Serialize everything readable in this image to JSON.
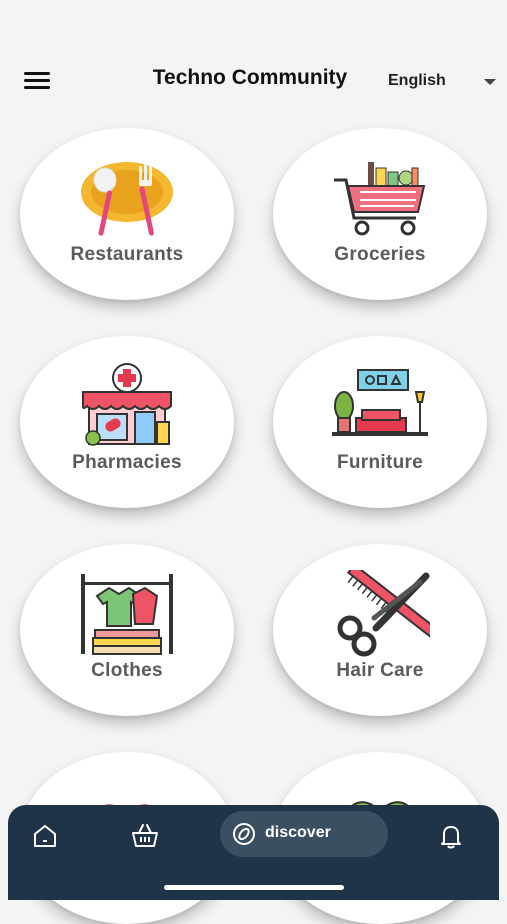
{
  "header": {
    "title": "Techno Community",
    "language": "English"
  },
  "categories": [
    {
      "label": "Restaurants",
      "icon": "restaurant-icon"
    },
    {
      "label": "Groceries",
      "icon": "grocery-cart-icon"
    },
    {
      "label": "Pharmacies",
      "icon": "pharmacy-icon"
    },
    {
      "label": "Furniture",
      "icon": "furniture-icon"
    },
    {
      "label": "Clothes",
      "icon": "clothes-rack-icon"
    },
    {
      "label": "Hair Care",
      "icon": "hair-care-icon"
    },
    {
      "label": "",
      "icon": "health-heart-icon"
    },
    {
      "label": "",
      "icon": "pet-icon"
    }
  ],
  "bottom_nav": {
    "items": [
      "home-icon",
      "basket-icon",
      "discover-icon",
      "bell-icon"
    ],
    "discover_label": "discover"
  },
  "colors": {
    "background": "#f4f4f4",
    "nav_background": "#1f3349",
    "nav_pill": "#3b4f63",
    "label_gray": "#5b5b5b"
  }
}
